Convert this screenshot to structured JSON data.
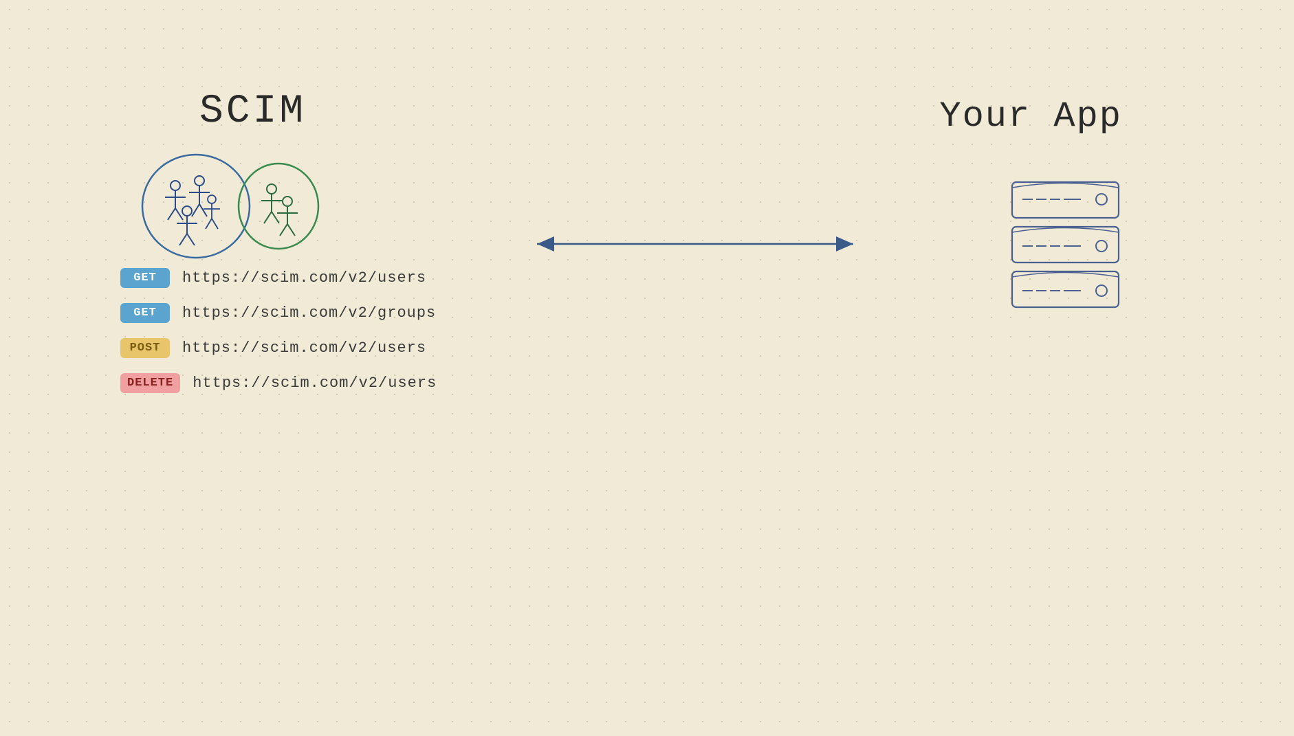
{
  "scim_title": "SCIM",
  "your_app_title": "Your App",
  "endpoints": [
    {
      "method": "GET",
      "url": "https://scim.com/v2/users",
      "style": "get"
    },
    {
      "method": "GET",
      "url": "https://scim.com/v2/groups",
      "style": "get"
    },
    {
      "method": "POST",
      "url": "https://scim.com/v2/users",
      "style": "post"
    },
    {
      "method": "DELETE",
      "url": "https://scim.com/v2/users",
      "style": "delete"
    }
  ],
  "colors": {
    "background": "#f0ead6",
    "dots": "#c8bfa0",
    "get_bg": "#5ba4cf",
    "post_bg": "#e8c56a",
    "delete_bg": "#f0a0a0",
    "arrow": "#3a5a8a",
    "group1_stroke": "#3a6aa0",
    "group2_stroke": "#3a8a50",
    "server_stroke": "#4a6090"
  }
}
